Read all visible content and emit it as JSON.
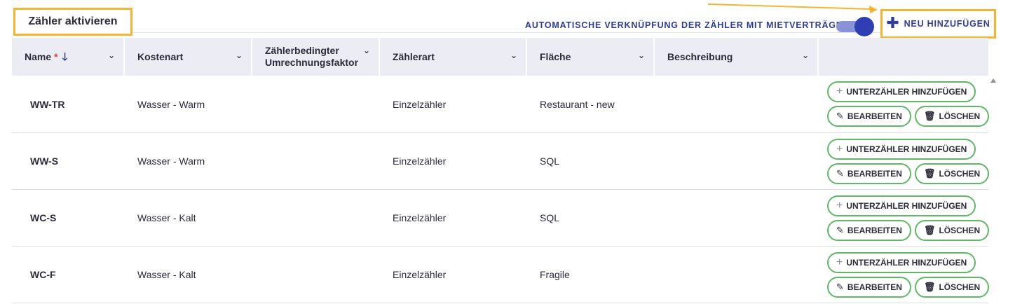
{
  "tabs": {
    "active_label": "Zähler aktivieren"
  },
  "toolbar": {
    "auto_link_label": "AUTOMATISCHE VERKNÜPFUNG DER ZÄHLER MIT MIETVERTRÄGEN",
    "auto_link_enabled": true,
    "add_new_label": "NEU HINZUFÜGEN"
  },
  "colors": {
    "accent": "#2e3c9a",
    "highlight": "#f4b631",
    "button_border": "#5fb866",
    "required": "#e0393e",
    "header_bg": "#ecedf4"
  },
  "table": {
    "columns": [
      {
        "key": "name",
        "label": "Name",
        "required_mark": "*",
        "sort_icon": "arrow-down-icon"
      },
      {
        "key": "kostenart",
        "label": "Kostenart"
      },
      {
        "key": "faktor",
        "label_line1": "Zählerbedingter",
        "label_line2": "Umrechnungsfaktor"
      },
      {
        "key": "zaehlerart",
        "label": "Zählerart"
      },
      {
        "key": "flaeche",
        "label": "Fläche"
      },
      {
        "key": "beschreibung",
        "label": "Beschreibung"
      },
      {
        "key": "actions",
        "label": ""
      }
    ],
    "rows": [
      {
        "name": "WW-TR",
        "kostenart": "Wasser - Warm",
        "faktor": "",
        "zaehlerart": "Einzelzähler",
        "flaeche": "Restaurant - new",
        "beschreibung": ""
      },
      {
        "name": "WW-S",
        "kostenart": "Wasser - Warm",
        "faktor": "",
        "zaehlerart": "Einzelzähler",
        "flaeche": "SQL",
        "beschreibung": ""
      },
      {
        "name": "WC-S",
        "kostenart": "Wasser - Kalt",
        "faktor": "",
        "zaehlerart": "Einzelzähler",
        "flaeche": "SQL",
        "beschreibung": ""
      },
      {
        "name": "WC-F",
        "kostenart": "Wasser - Kalt",
        "faktor": "",
        "zaehlerart": "Einzelzähler",
        "flaeche": "Fragile",
        "beschreibung": ""
      }
    ],
    "row_actions": {
      "add_sub_label": "UNTERZÄHLER HINZUFÜGEN",
      "edit_label": "BEARBEITEN",
      "delete_label": "LÖSCHEN"
    }
  }
}
